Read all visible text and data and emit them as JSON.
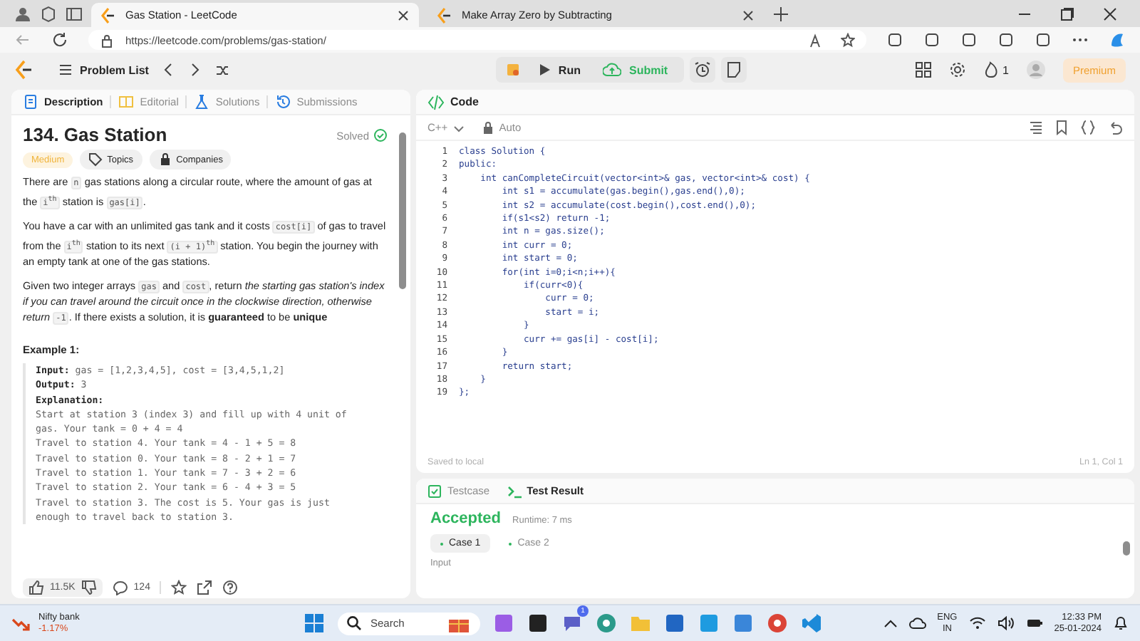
{
  "browser": {
    "tabs": [
      {
        "title": "Gas Station - LeetCode",
        "selected": true
      },
      {
        "title": "Make Array Zero by Subtracting",
        "selected": false
      }
    ],
    "url": "https://leetcode.com/problems/gas-station/"
  },
  "header": {
    "problem_list": "Problem List",
    "run": "Run",
    "submit": "Submit",
    "streak": "1",
    "premium": "Premium"
  },
  "description": {
    "tabs": [
      {
        "label": "Description",
        "selected": true
      },
      {
        "label": "Editorial",
        "selected": false
      },
      {
        "label": "Solutions",
        "selected": false
      },
      {
        "label": "Submissions",
        "selected": false
      }
    ],
    "title": "134. Gas Station",
    "status": "Solved",
    "difficulty": "Medium",
    "tags": [
      "Topics",
      "Companies"
    ],
    "paragraphs": [
      [
        {
          "kind": "text",
          "text": "There are "
        },
        {
          "kind": "code",
          "text": "n"
        },
        {
          "kind": "text",
          "text": " gas stations along a circular route, where the amount of gas at the "
        },
        {
          "kind": "code",
          "text": "i$^{th}$"
        },
        {
          "kind": "text",
          "text": " station is "
        },
        {
          "kind": "code",
          "text": "gas[i]"
        },
        {
          "kind": "text",
          "text": "."
        }
      ],
      [
        {
          "kind": "text",
          "text": "You have a car with an unlimited gas tank and it costs "
        },
        {
          "kind": "code",
          "text": "cost[i]"
        },
        {
          "kind": "text",
          "text": " of gas to travel from the "
        },
        {
          "kind": "code",
          "text": "i$^{th}$"
        },
        {
          "kind": "text",
          "text": " station to its next "
        },
        {
          "kind": "code",
          "text": "(i + 1)$^{th}$"
        },
        {
          "kind": "text",
          "text": " station. You begin the journey with an empty tank at one of the gas stations."
        }
      ],
      [
        {
          "kind": "text",
          "text": "Given two integer arrays "
        },
        {
          "kind": "code",
          "text": "gas"
        },
        {
          "kind": "text",
          "text": " and "
        },
        {
          "kind": "code",
          "text": "cost"
        },
        {
          "kind": "text",
          "text": ", return *the starting gas station's index if you can travel around the circuit once in the clockwise direction, otherwise return* "
        },
        {
          "kind": "code",
          "text": "-1"
        },
        {
          "kind": "text",
          "text": ". If there exists a solution, it is **guaranteed** to be **unique**"
        }
      ]
    ],
    "example_title": "Example 1:",
    "example_lines": [
      "**Input:** gas = [1,2,3,4,5], cost = [3,4,5,1,2]",
      "**Output:** 3",
      "**Explanation:**",
      "Start at station 3 (index 3) and fill up with 4 unit of",
      "gas. Your tank = 0 + 4 = 4",
      "Travel to station 4. Your tank = 4 - 1 + 5 = 8",
      "Travel to station 0. Your tank = 8 - 2 + 1 = 7",
      "Travel to station 1. Your tank = 7 - 3 + 2 = 6",
      "Travel to station 2. Your tank = 6 - 4 + 3 = 5",
      "Travel to station 3. The cost is 5. Your gas is just",
      "enough to travel back to station 3."
    ],
    "likes": "11.5K",
    "comments": "124"
  },
  "editor": {
    "title": "Code",
    "language": "C++",
    "mode": "Auto",
    "lines": [
      {
        "number": "1",
        "code": "class Solution {"
      },
      {
        "number": "2",
        "code": "public:"
      },
      {
        "number": "3",
        "code": "    int canCompleteCircuit(vector<int>& gas, vector<int>& cost) {"
      },
      {
        "number": "4",
        "code": "        int s1 = accumulate(gas.begin(),gas.end(),0);"
      },
      {
        "number": "5",
        "code": "        int s2 = accumulate(cost.begin(),cost.end(),0);"
      },
      {
        "number": "6",
        "code": "        if(s1<s2) return -1;"
      },
      {
        "number": "7",
        "code": "        int n = gas.size();"
      },
      {
        "number": "8",
        "code": "        int curr = 0;"
      },
      {
        "number": "9",
        "code": "        int start = 0;"
      },
      {
        "number": "10",
        "code": "        for(int i=0;i<n;i++){"
      },
      {
        "number": "11",
        "code": "            if(curr<0){"
      },
      {
        "number": "12",
        "code": "                curr = 0;"
      },
      {
        "number": "13",
        "code": "                start = i;"
      },
      {
        "number": "14",
        "code": "            }"
      },
      {
        "number": "15",
        "code": "            curr += gas[i] - cost[i];"
      },
      {
        "number": "16",
        "code": "        }"
      },
      {
        "number": "17",
        "code": "        return start;"
      },
      {
        "number": "18",
        "code": "    }"
      },
      {
        "number": "19",
        "code": "};"
      }
    ],
    "save_status": "Saved to local",
    "cursor": "Ln 1, Col 1"
  },
  "results": {
    "tabs": [
      {
        "label": "Testcase",
        "selected": false
      },
      {
        "label": "Test Result",
        "selected": true
      }
    ],
    "verdict": "Accepted",
    "runtime": "Runtime: 7 ms",
    "cases": [
      {
        "label": "Case 1",
        "selected": true
      },
      {
        "label": "Case 2",
        "selected": false
      }
    ],
    "input_label": "Input"
  },
  "taskbar": {
    "widget_title": "Nifty bank",
    "widget_change": "-1.17%",
    "search_placeholder": "Search",
    "notification_count": "1",
    "language": "ENG",
    "region": "IN",
    "time": "12:33 PM",
    "date": "25-01-2024"
  }
}
